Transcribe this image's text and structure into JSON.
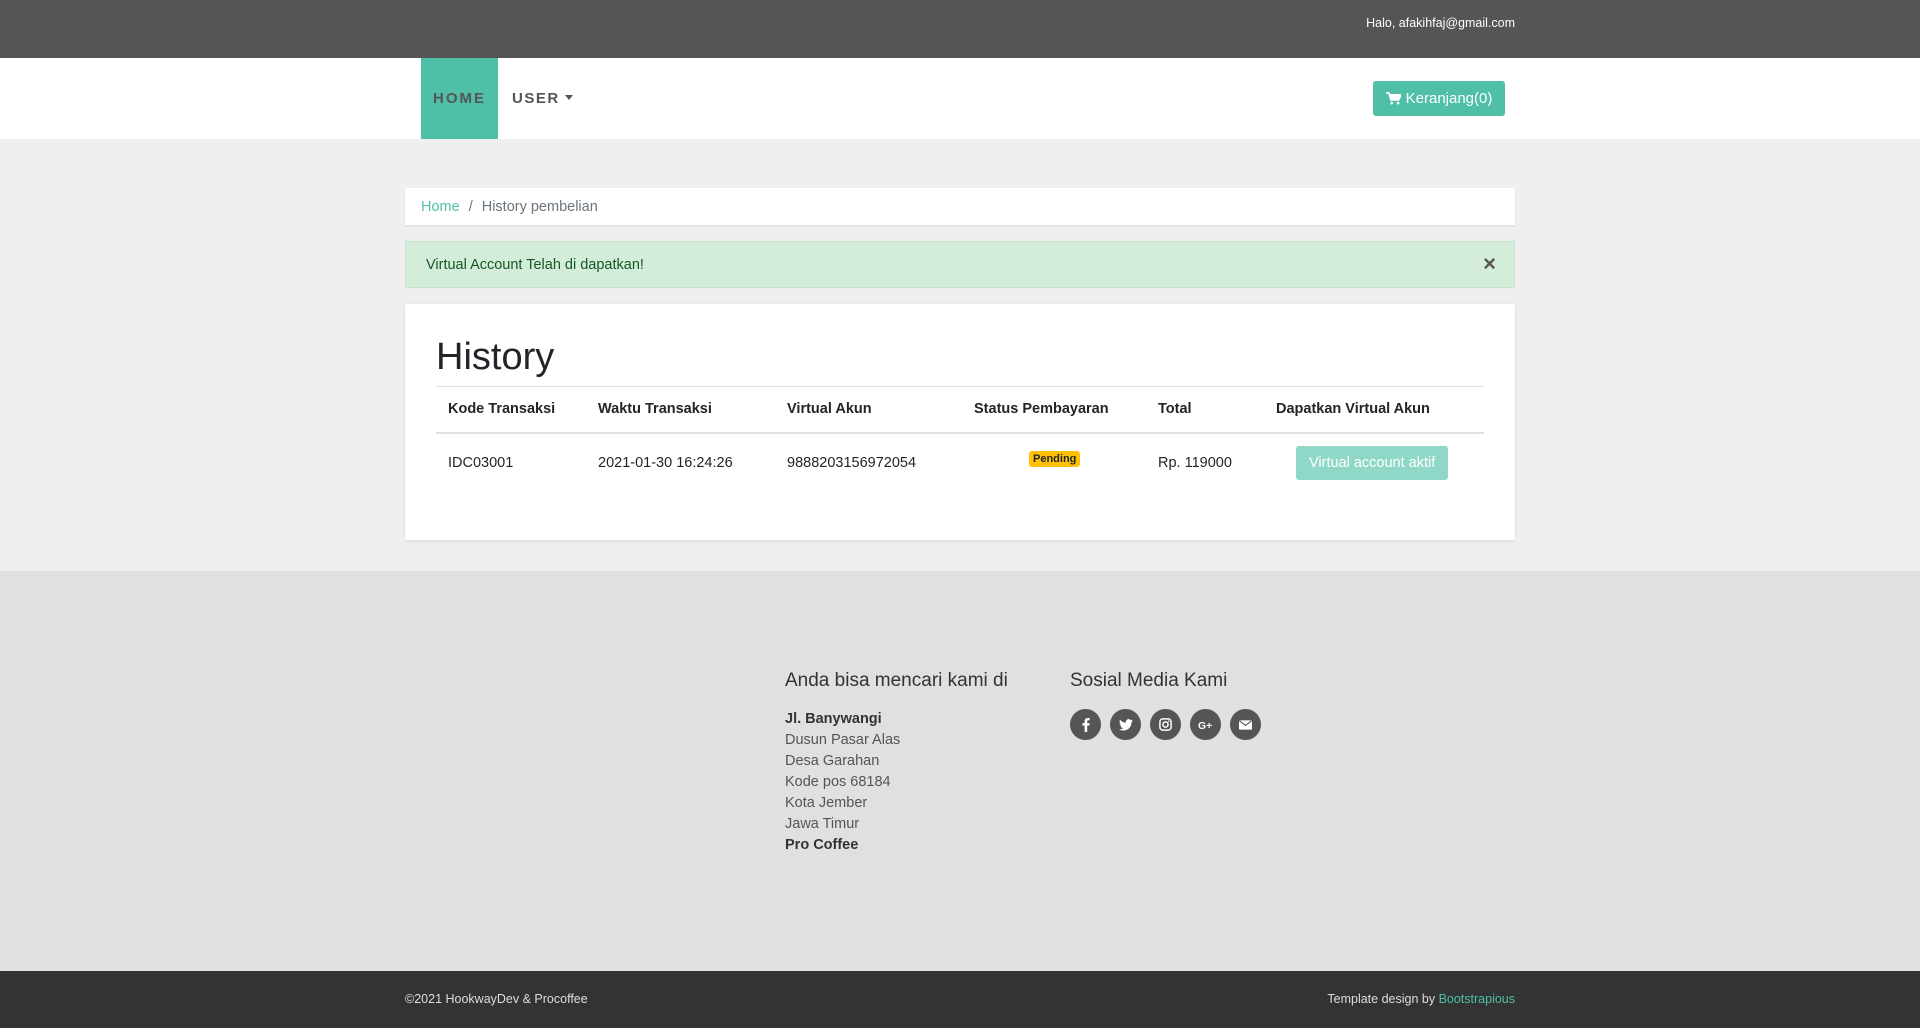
{
  "topbar": {
    "greeting": "Halo, afakihfaj@gmail.com"
  },
  "nav": {
    "home": "HOME",
    "user": "USER",
    "cart": "Keranjang(0)"
  },
  "breadcrumb": {
    "home": "Home",
    "separator": "/",
    "current": "History pembelian"
  },
  "alert": {
    "message": "Virtual Account Telah di dapatkan!",
    "close": "×"
  },
  "history": {
    "title": "History",
    "columns": [
      "Kode Transaksi",
      "Waktu Transaksi",
      "Virtual Akun",
      "Status Pembayaran",
      "Total",
      "Dapatkan Virtual Akun"
    ],
    "rows": [
      {
        "kode": "IDC03001",
        "waktu": "2021-01-30 16:24:26",
        "virtual_akun": "9888203156972054",
        "status": "Pending",
        "total": "Rp. 119000",
        "action": "Virtual account aktif"
      }
    ]
  },
  "footer": {
    "address_title": "Anda bisa mencari kami di",
    "address_lines": [
      "Jl. Banywangi",
      "Dusun Pasar Alas",
      "Desa Garahan",
      "Kode pos 68184",
      "Kota Jember",
      "Jawa Timur",
      "Pro Coffee"
    ],
    "social_title": "Sosial Media Kami",
    "social_icons": [
      "facebook-icon",
      "twitter-icon",
      "instagram-icon",
      "google-plus-icon",
      "email-icon"
    ]
  },
  "copyright": {
    "left": "©2021 HookwayDev & Procoffee",
    "right_prefix": "Template design by ",
    "right_link": "Bootstrapious"
  },
  "colors": {
    "accent": "#4fbfa8",
    "topbar": "#555555",
    "alert_bg": "#d4edda",
    "badge": "#ffc107"
  }
}
